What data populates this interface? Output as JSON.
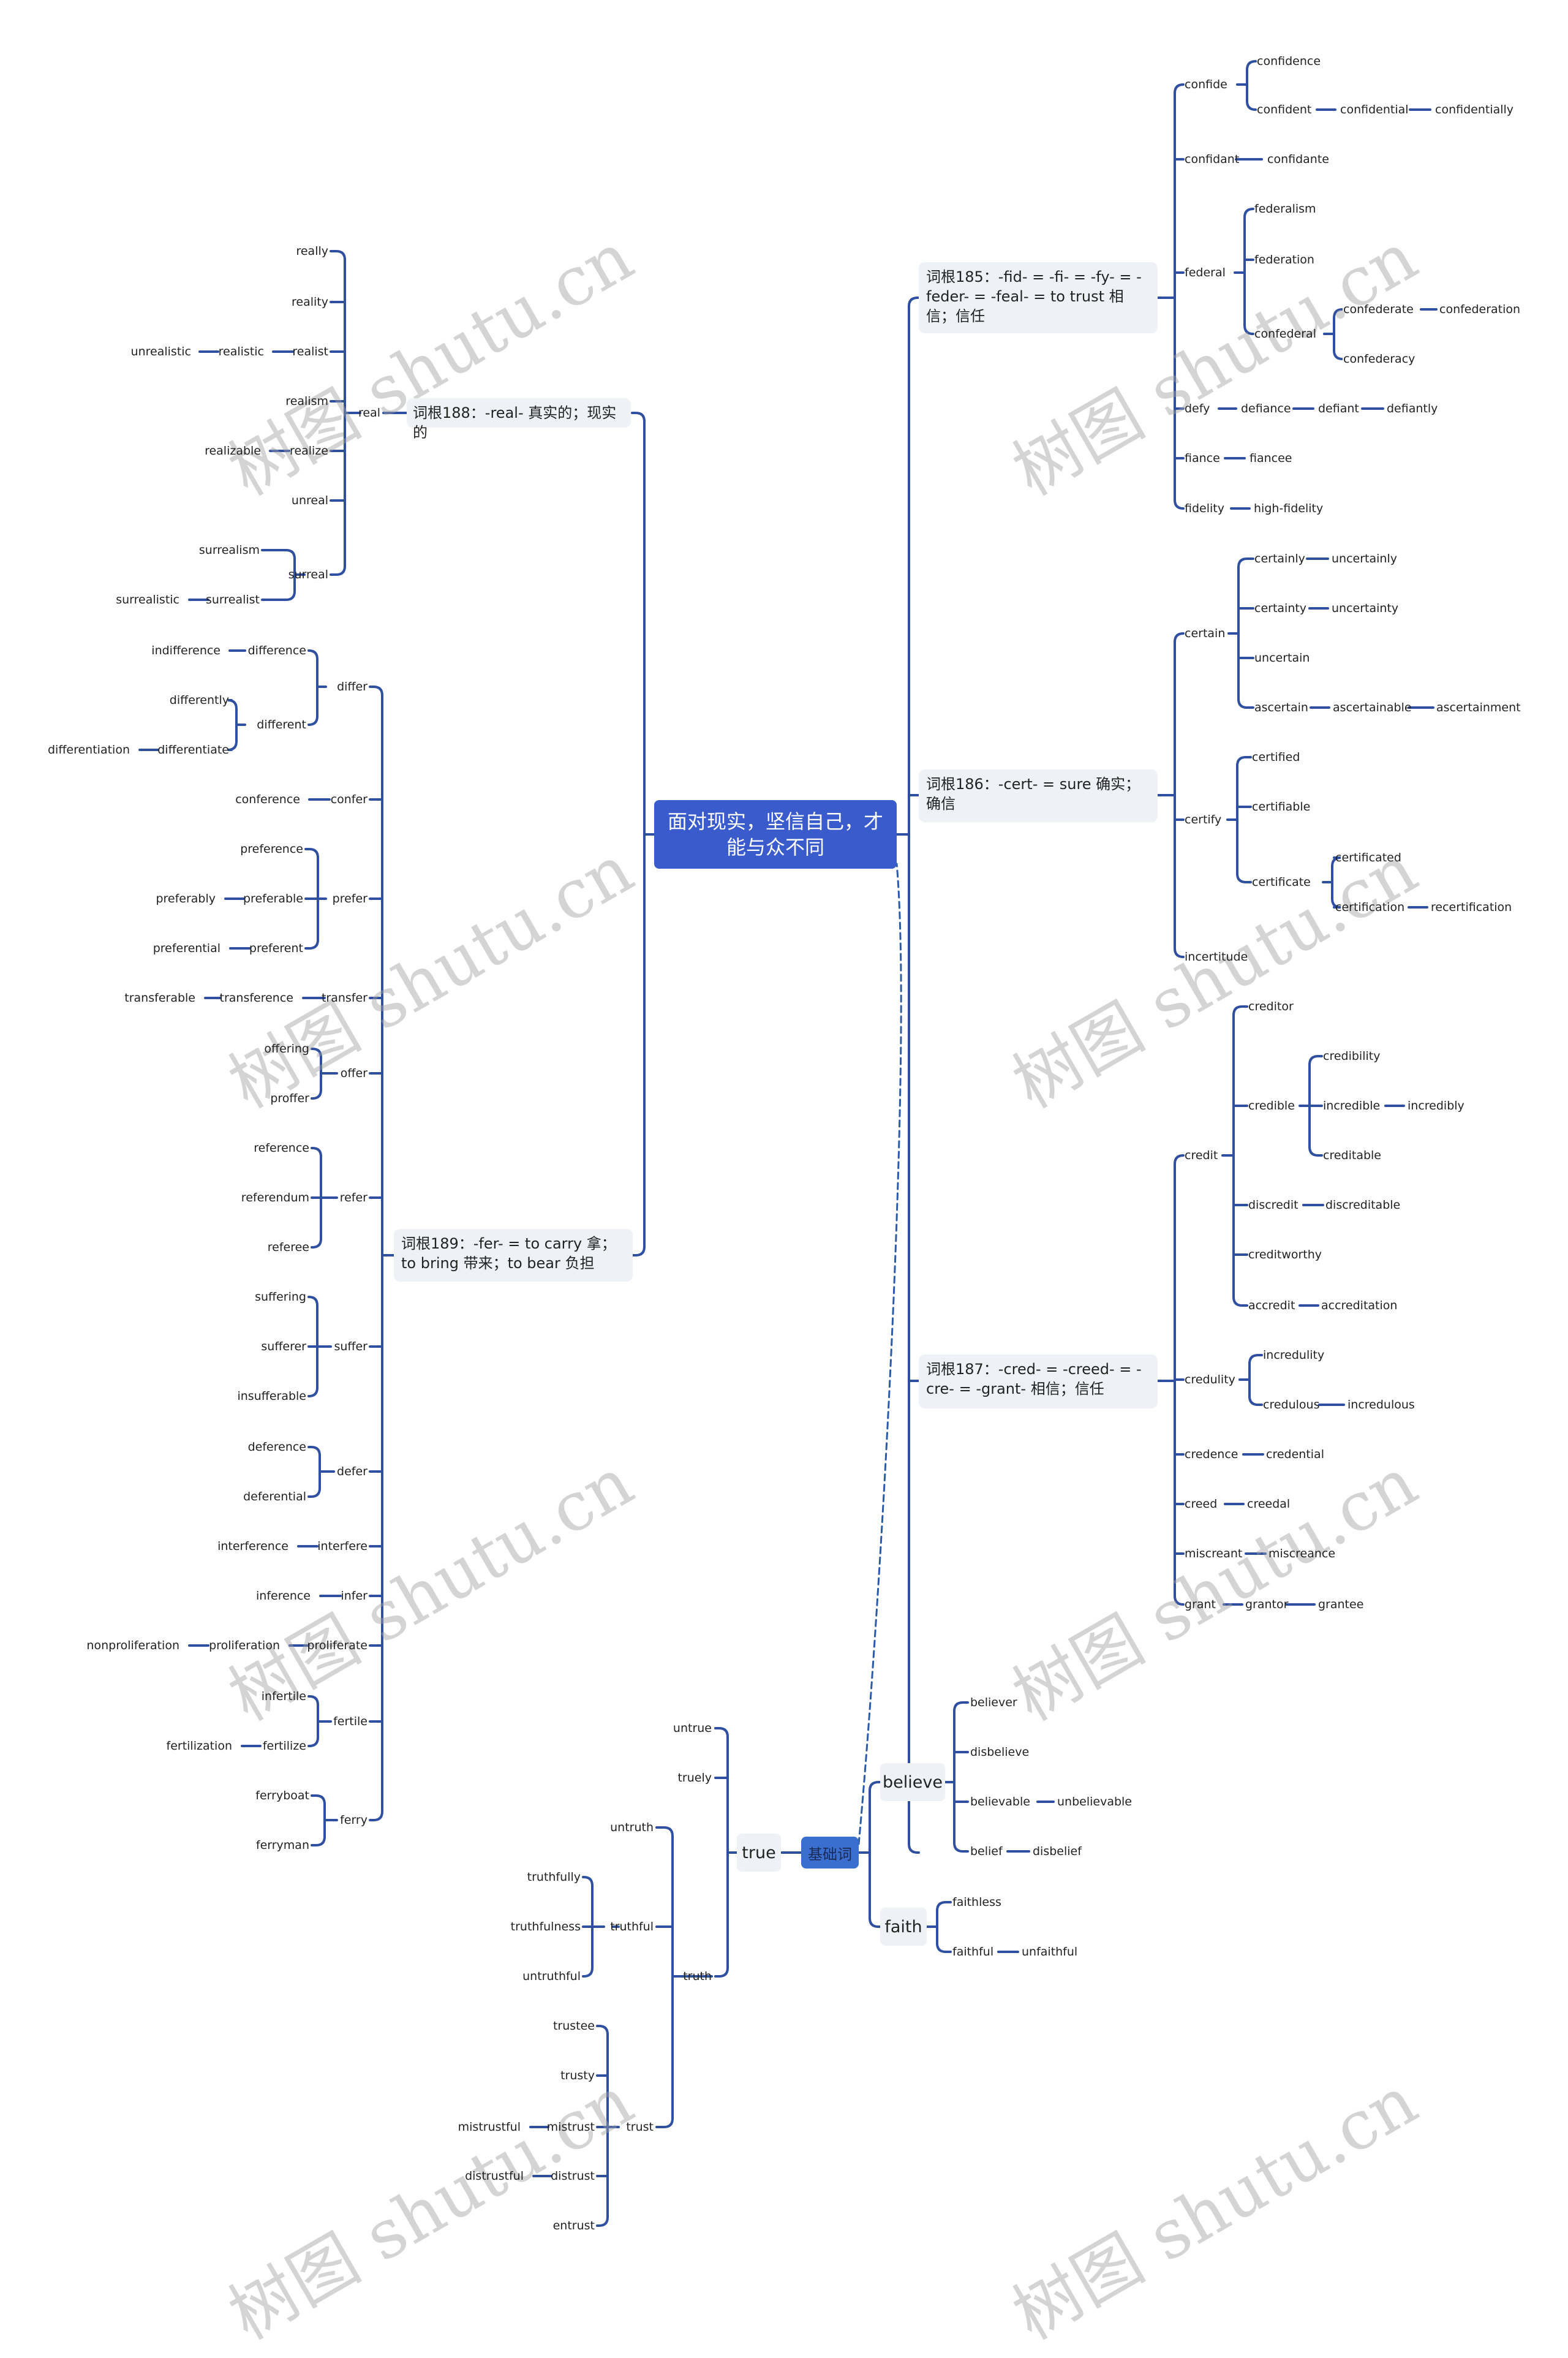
{
  "colors": {
    "line": "#2f4fa0",
    "root_bg": "#3a5bcc",
    "basic_bg": "#3a6fd0",
    "topic_bg": "#eef1f5",
    "dashed": "#2a5aa8"
  },
  "watermark": "树图 shutu.cn",
  "root": {
    "label": "面对现实，坚信自己，才能与众不同"
  },
  "topics": {
    "t185": {
      "label": "词根185：-fid- = -fi- = -fy- = -feder- = -feal- = to trust 相信；信任"
    },
    "t186": {
      "label": "词根186：-cert- = sure 确实；确信"
    },
    "t187": {
      "label": "词根187：-cred- = -creed- = -cre- = -grant- 相信；信任"
    },
    "t188": {
      "label": "词根188：-real- 真实的；现实的"
    },
    "t189": {
      "label": "词根189：-fer- = to carry 拿；to bring 带来；to bear 负担"
    },
    "basic": {
      "label": "基础词"
    },
    "believe": {
      "label": "believe"
    },
    "faith": {
      "label": "faith"
    },
    "true": {
      "label": "true"
    }
  },
  "words": {
    "confide": "confide",
    "confidence": "confidence",
    "confident": "confident",
    "confidential": "confidential",
    "confidentially": "confidentially",
    "confidant": "confidant",
    "confidante": "confidante",
    "federal": "federal",
    "federalism": "federalism",
    "federation": "federation",
    "confederal": "confederal",
    "confederate": "confederate",
    "confederation": "confederation",
    "confederacy": "confederacy",
    "defy": "defy",
    "defiance": "defiance",
    "defiant": "defiant",
    "defiantly": "defiantly",
    "fiance": "fiance",
    "fiancee": "fiancee",
    "fidelity": "fidelity",
    "high_fidelity": "high-fidelity",
    "certain": "certain",
    "certainly": "certainly",
    "uncertainly": "uncertainly",
    "certainty": "certainty",
    "uncertainty": "uncertainty",
    "uncertain": "uncertain",
    "ascertain": "ascertain",
    "ascertainable": "ascertainable",
    "ascertainment": "ascertainment",
    "certify": "certify",
    "certified": "certified",
    "certifiable": "certifiable",
    "certificate": "certificate",
    "certificated": "certificated",
    "certification": "certification",
    "recertification": "recertification",
    "incertitude": "incertitude",
    "credit": "credit",
    "creditor": "creditor",
    "credible": "credible",
    "credibility": "credibility",
    "incredible": "incredible",
    "incredibly": "incredibly",
    "creditable": "creditable",
    "discredit": "discredit",
    "discreditable": "discreditable",
    "creditworthy": "creditworthy",
    "accredit": "accredit",
    "accreditation": "accreditation",
    "credulity": "credulity",
    "incredulity": "incredulity",
    "credulous": "credulous",
    "incredulous": "incredulous",
    "credence": "credence",
    "credential": "credential",
    "creed": "creed",
    "creedal": "creedal",
    "miscreant": "miscreant",
    "miscreance": "miscreance",
    "grant": "grant",
    "grantor": "grantor",
    "grantee": "grantee",
    "believer": "believer",
    "disbelieve": "disbelieve",
    "believable": "believable",
    "unbelievable": "unbelievable",
    "belief": "belief",
    "disbelief": "disbelief",
    "faithless": "faithless",
    "faithful": "faithful",
    "unfaithful": "unfaithful",
    "untrue": "untrue",
    "truely": "truely",
    "truth": "truth",
    "untruth": "untruth",
    "truthful": "truthful",
    "truthfully": "truthfully",
    "truthfulness": "truthfulness",
    "untruthful": "untruthful",
    "trust": "trust",
    "trustee": "trustee",
    "trusty": "trusty",
    "mistrust": "mistrust",
    "mistrustful": "mistrustful",
    "distrust": "distrust",
    "distrustful": "distrustful",
    "entrust": "entrust",
    "real": "real",
    "really": "really",
    "reality": "reality",
    "realist": "realist",
    "realistic": "realistic",
    "unrealistic": "unrealistic",
    "realism": "realism",
    "realize": "realize",
    "realizable": "realizable",
    "unreal": "unreal",
    "surreal": "surreal",
    "surrealism": "surrealism",
    "surrealist": "surrealist",
    "surrealistic": "surrealistic",
    "differ": "differ",
    "difference": "difference",
    "indifference": "indifference",
    "different": "different",
    "differently": "differently",
    "differentiate": "differentiate",
    "differentiation": "differentiation",
    "confer": "confer",
    "conference": "conference",
    "prefer": "prefer",
    "preference": "preference",
    "preferable": "preferable",
    "preferably": "preferably",
    "preferent": "preferent",
    "preferential": "preferential",
    "transfer": "transfer",
    "transference": "transference",
    "transferable": "transferable",
    "offer": "offer",
    "offering": "offering",
    "proffer": "proffer",
    "refer": "refer",
    "reference": "reference",
    "referendum": "referendum",
    "referee": "referee",
    "suffer": "suffer",
    "suffering": "suffering",
    "sufferer": "sufferer",
    "insufferable": "insufferable",
    "defer": "defer",
    "deference": "deference",
    "deferential": "deferential",
    "interfere": "interfere",
    "interference": "interference",
    "infer": "infer",
    "inference": "inference",
    "proliferate": "proliferate",
    "proliferation": "proliferation",
    "nonproliferation": "nonproliferation",
    "fertile": "fertile",
    "infertile": "infertile",
    "fertilize": "fertilize",
    "fertilization": "fertilization",
    "ferry": "ferry",
    "ferryboat": "ferryboat",
    "ferryman": "ferryman"
  }
}
